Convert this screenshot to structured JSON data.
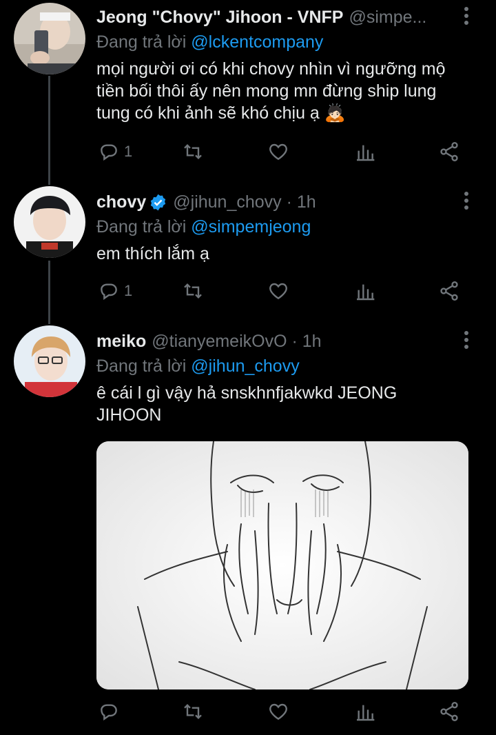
{
  "tweets": [
    {
      "name": "Jeong \"Chovy\" Jihoon - VNFP",
      "handle": "@simpe...",
      "reply_prefix": "Đang trả lời",
      "reply_to": "@lckentcompany",
      "text": "mọi người ơi có khi chovy nhìn vì ngưỡng mộ tiền bối thôi ấy nên mong mn đừng ship lung tung có khi ảnh sẽ khó chịu ạ 🙇🏻",
      "reply_count": "1",
      "avatar": "selfie-avatar"
    },
    {
      "name": "chovy",
      "handle": "@jihun_chovy · 1h",
      "verified": true,
      "reply_prefix": "Đang trả lời",
      "reply_to": "@simpemjeong",
      "text": "em thích lắm ạ",
      "reply_count": "1",
      "avatar": "chovy-avatar"
    },
    {
      "name": "meiko",
      "handle": "@tianyemeikOvO · 1h",
      "reply_prefix": "Đang trả lời",
      "reply_to": "@jihun_chovy",
      "text": "ê cái l gì vậy hả snskhnfjakwkd JEONG JIHOON",
      "reply_count": "",
      "avatar": "meiko-avatar",
      "media": "sketch of a crying face covered by hands"
    }
  ],
  "colors": {
    "background": "#000000",
    "accent": "#1d9bf0",
    "muted": "#71767b",
    "text": "#e7e9ea"
  },
  "icons": [
    "reply-icon",
    "retweet-icon",
    "like-icon",
    "analytics-icon",
    "share-icon",
    "more-icon",
    "verified-icon"
  ]
}
